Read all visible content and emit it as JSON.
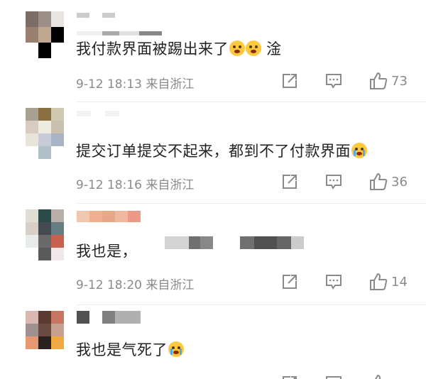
{
  "comments": [
    {
      "avatar_colors": [
        "#7a6e66",
        "#9a8e86",
        "#e8e4e0",
        "#9a8070",
        "#c0a890",
        "#ffffff",
        "#ffffff",
        "#000000",
        "#ffffff"
      ],
      "username_colors": [
        "#cccccc",
        "#ffffff",
        "#cccccc"
      ],
      "text": "我付款界面被踢出来了",
      "text_after": " 淦",
      "emojis": [
        "scared-emoji",
        "scared-emoji"
      ],
      "date": "9-12 18:13",
      "location": "来自浙江",
      "likes": "73"
    },
    {
      "avatar_colors": [
        "#a8a090",
        "#8a7040",
        "#d0c8b0",
        "#d8ccc0",
        "#eeebe0",
        "#c8c0b0",
        "#e8e4da",
        "#c8ccd8",
        "#a8b4c4"
      ],
      "username_colors": [
        "#f2f2f2",
        "#ffffff",
        "#f2f2f2"
      ],
      "text": "提交订单提交不起来，都到不了付款界面",
      "text_after": "",
      "emojis": [
        "crying-emoji"
      ],
      "date": "9-12 18:16",
      "location": "来自浙江",
      "likes": "36"
    },
    {
      "avatar_colors": [
        "#e0ddd5",
        "#2c4a48",
        "#b8b0a8",
        "#d8d0c8",
        "#444a50",
        "#687c84",
        "#b8c8c0",
        "#d0d4d0",
        "#c86050"
      ],
      "username_colors": [
        "#f0c8b0",
        "#f0b090",
        "#e8a888",
        "#f09888"
      ],
      "text": "我也是，",
      "text_after": "",
      "emojis": [],
      "date": "9-12 18:20",
      "location": "来自浙江",
      "likes": "14"
    },
    {
      "avatar_colors": [
        "#d8b8b0",
        "#5a3a30",
        "#c87860",
        "#a09090",
        "#6a4a40",
        "#c8a090",
        "#e89870",
        "#2a2020",
        "#f0a840"
      ],
      "username_colors": [
        "#505050",
        "#ffffff",
        "#808080",
        "#b0b0b0"
      ],
      "text": "我也是气死了",
      "text_after": "",
      "emojis": [
        "crying-emoji"
      ],
      "date": "",
      "location": "",
      "likes": ""
    }
  ],
  "colors": {
    "text": "#222222",
    "meta": "#8a8a8a",
    "icon": "#8a8a8a",
    "emoji": "#ffc83d"
  }
}
